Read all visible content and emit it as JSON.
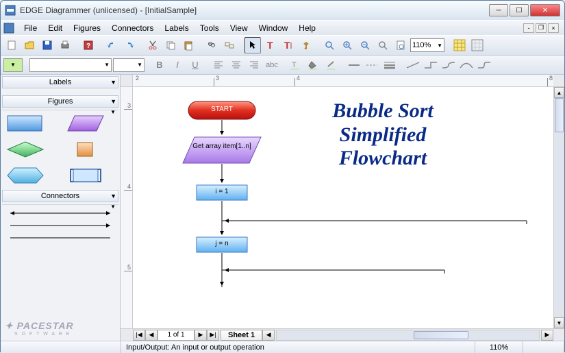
{
  "window": {
    "title": "EDGE Diagrammer (unlicensed) - [InitialSample]"
  },
  "menu": [
    "File",
    "Edit",
    "Figures",
    "Connectors",
    "Labels",
    "Tools",
    "View",
    "Window",
    "Help"
  ],
  "zoom": "110%",
  "format": {
    "bold": "B",
    "italic": "I",
    "underline": "U",
    "abc": "abc"
  },
  "left": {
    "labels_section": "Labels",
    "figures_section": "Figures",
    "connectors_section": "Connectors",
    "logo": "PACESTAR",
    "logo_sub": "S O F T W A R E"
  },
  "ruler_h": [
    "2",
    "3",
    "4",
    "8"
  ],
  "ruler_v": [
    "3",
    "4",
    "5"
  ],
  "flowchart": {
    "title_line1": "Bubble Sort",
    "title_line2": "Simplified",
    "title_line3": "Flowchart",
    "start": "START",
    "input": "Get array item[1..n]",
    "step1": "i = 1",
    "step2": "j = n"
  },
  "pager": {
    "label": "1 of 1",
    "sheet": "Sheet 1"
  },
  "status": {
    "text": "Input/Output: An input or output operation",
    "zoom": "110%"
  }
}
